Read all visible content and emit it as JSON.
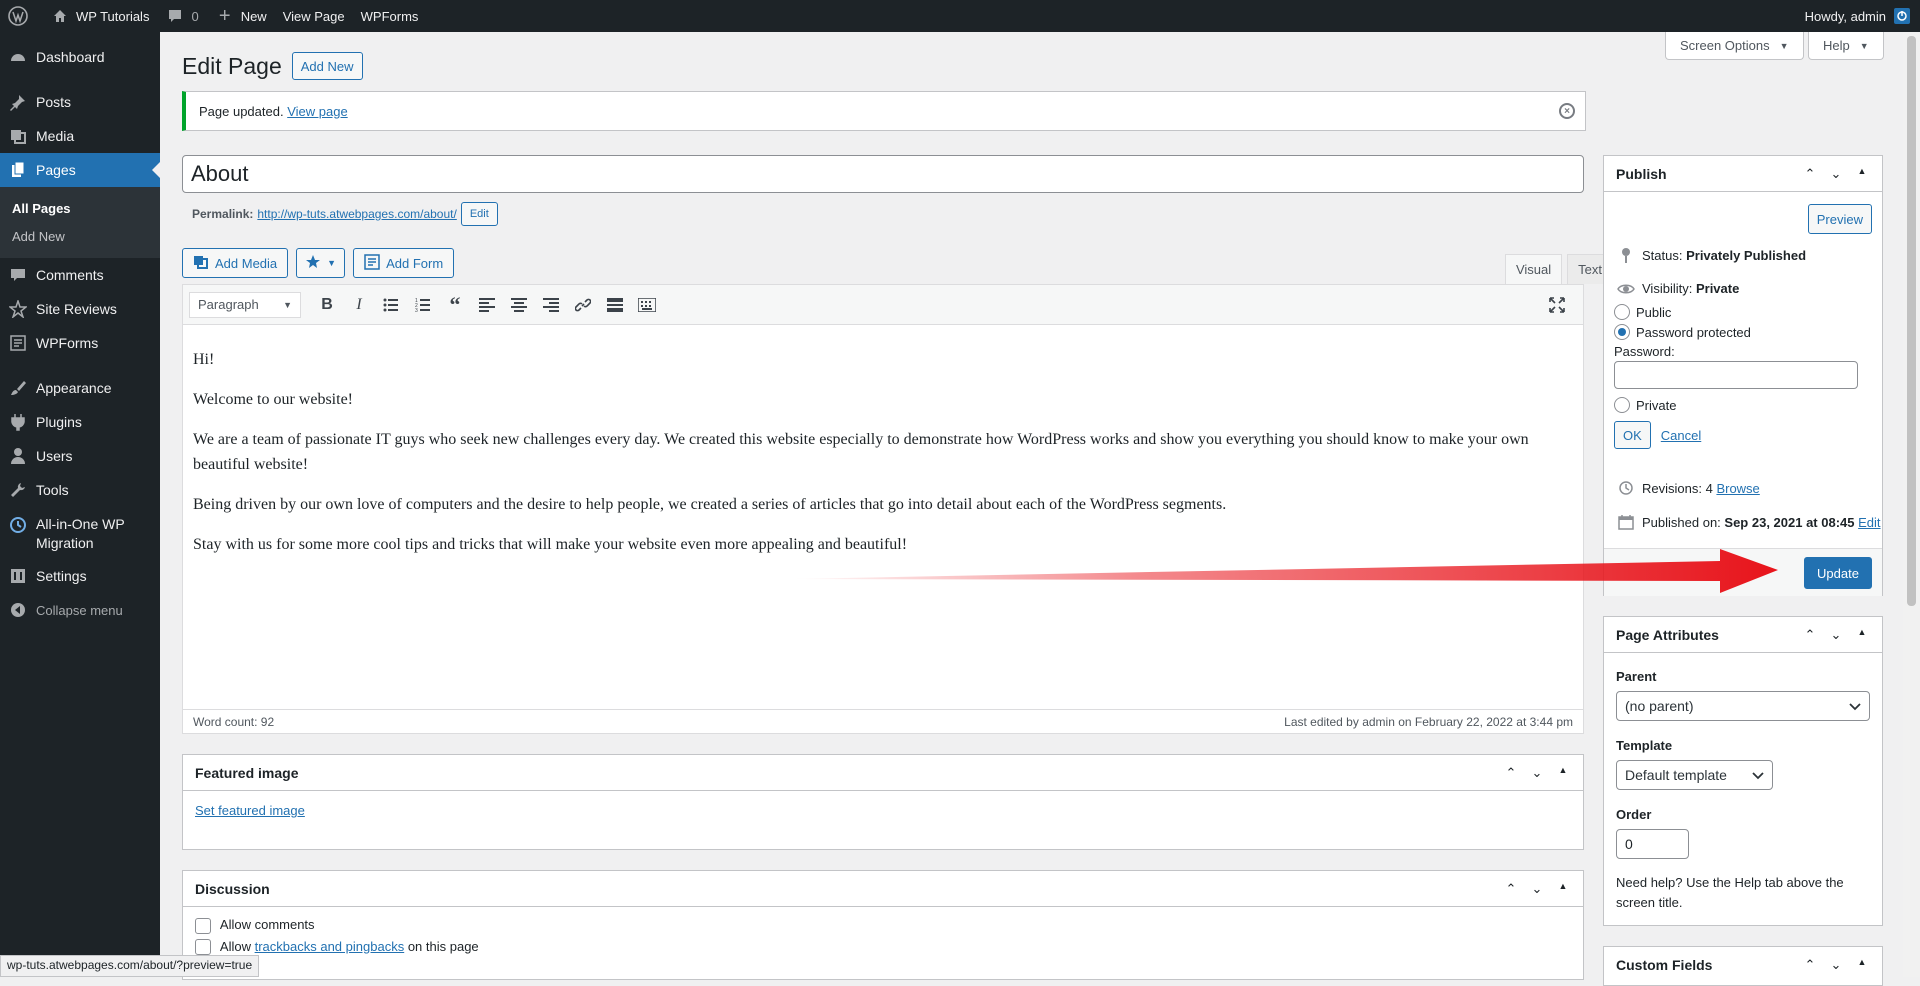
{
  "admin_bar": {
    "site_name": "WP Tutorials",
    "comments_count": "0",
    "new_label": "New",
    "view_page": "View Page",
    "wpforms": "WPForms",
    "howdy": "Howdy, admin"
  },
  "sidebar": {
    "items": [
      {
        "label": "Dashboard"
      },
      {
        "label": "Posts"
      },
      {
        "label": "Media"
      },
      {
        "label": "Pages"
      },
      {
        "label": "Comments"
      },
      {
        "label": "Site Reviews"
      },
      {
        "label": "WPForms"
      },
      {
        "label": "Appearance"
      },
      {
        "label": "Plugins"
      },
      {
        "label": "Users"
      },
      {
        "label": "Tools"
      },
      {
        "label": "All-in-One WP Migration"
      },
      {
        "label": "Settings"
      },
      {
        "label": "Collapse menu"
      }
    ],
    "submenu": [
      "All Pages",
      "Add New"
    ]
  },
  "header": {
    "screen_options": "Screen Options",
    "help": "Help",
    "title": "Edit Page",
    "add_new": "Add New"
  },
  "notice": {
    "text": "Page updated.",
    "link": "View page"
  },
  "editor": {
    "title_value": "About",
    "permalink_label": "Permalink:",
    "permalink_url": "http://wp-tuts.atwebpages.com/about/",
    "permalink_edit": "Edit",
    "add_media": "Add Media",
    "add_form": "Add Form",
    "tab_visual": "Visual",
    "tab_text": "Text",
    "format": "Paragraph",
    "paragraphs": [
      "Hi!",
      "Welcome to our website!",
      "We are a team of passionate IT guys who seek new challenges every day. We created this website especially to demonstrate how WordPress works and show you everything you should know to make your own beautiful website!",
      "Being driven by our own love of computers and the desire to help people, we created a series of articles that go into detail about each of the WordPress segments.",
      "Stay with us for some more cool tips and tricks that will make your website even more appealing and beautiful!"
    ],
    "word_count": "Word count: 92",
    "last_edited": "Last edited by admin on February 22, 2022 at 3:44 pm"
  },
  "featured_image": {
    "title": "Featured image",
    "link": "Set featured image"
  },
  "discussion": {
    "title": "Discussion",
    "allow_comments": "Allow comments",
    "allow_prefix": "Allow",
    "trackbacks_link": "trackbacks and pingbacks",
    "allow_suffix": "on this page"
  },
  "publish": {
    "title": "Publish",
    "preview": "Preview",
    "status_label": "Status:",
    "status_value": "Privately Published",
    "visibility_label": "Visibility:",
    "visibility_value": "Private",
    "opt_public": "Public",
    "opt_password": "Password protected",
    "password_label": "Password:",
    "opt_private": "Private",
    "ok": "OK",
    "cancel": "Cancel",
    "revisions_label": "Revisions: 4",
    "revisions_link": "Browse",
    "published_label": "Published on:",
    "published_value": "Sep 23, 2021 at 08:45",
    "published_edit": "Edit",
    "update": "Update"
  },
  "page_attributes": {
    "title": "Page Attributes",
    "parent_label": "Parent",
    "parent_value": "(no parent)",
    "template_label": "Template",
    "template_value": "Default template",
    "order_label": "Order",
    "order_value": "0",
    "help_text": "Need help? Use the Help tab above the screen title."
  },
  "custom_fields": {
    "title": "Custom Fields"
  },
  "status_url": "wp-tuts.atwebpages.com/about/?preview=true",
  "colors": {
    "accent": "#2271b1",
    "admin_bar": "#1d2327",
    "notice_success": "#00a32a",
    "arrow": "#e8141b"
  }
}
